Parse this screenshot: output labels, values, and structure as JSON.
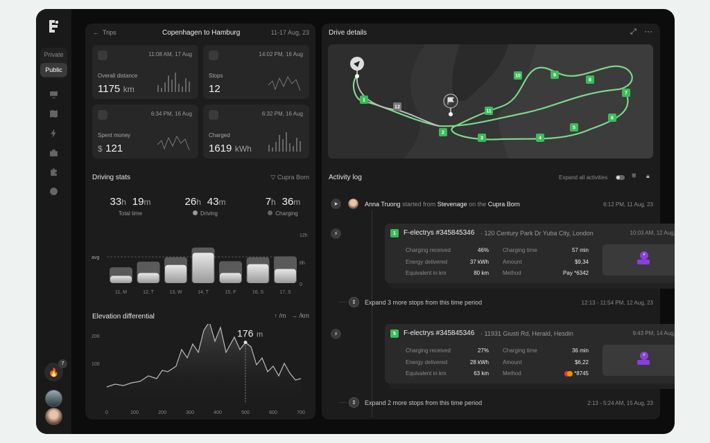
{
  "sidebar": {
    "visibility": [
      "Private",
      "Public"
    ],
    "notif_count": "7"
  },
  "trip": {
    "back": "Trips",
    "title": "Copenhagen to Hamburg",
    "dates": "11-17 Aug, 23"
  },
  "cards": [
    {
      "time": "11:08 AM, 17 Aug",
      "label": "Overall distance",
      "prefix": "",
      "value": "1175",
      "unit": "km"
    },
    {
      "time": "14:02 PM, 16 Aug",
      "label": "Stops",
      "prefix": "",
      "value": "12",
      "unit": ""
    },
    {
      "time": "6:34 PM, 16 Aug",
      "label": "Spent money",
      "prefix": "$",
      "value": "121",
      "unit": ""
    },
    {
      "time": "6:32 PM, 16 Aug",
      "label": "Charged",
      "prefix": "",
      "value": "1619",
      "unit": "kWh"
    }
  ],
  "driving": {
    "title": "Driving stats",
    "car": "Cupra Born",
    "stats": [
      {
        "h": "33",
        "hu": "h",
        "m": "19",
        "mu": "m",
        "label": "Total time"
      },
      {
        "h": "26",
        "hu": "h",
        "m": "43",
        "mu": "m",
        "label": "Driving"
      },
      {
        "h": "7",
        "hu": "h",
        "m": "36",
        "mu": "m",
        "label": "Charging"
      }
    ],
    "avg_label": "avg",
    "y_ticks": [
      "12h",
      "6h",
      "0"
    ]
  },
  "chart_data": [
    {
      "type": "bar",
      "categories": [
        "11, M",
        "12, T",
        "13, W",
        "14, T",
        "15, F",
        "16, S",
        "17, S"
      ],
      "series": [
        {
          "name": "Driving",
          "values": [
            1.8,
            2.5,
            4.5,
            7.5,
            2.5,
            4.7,
            3.5
          ]
        },
        {
          "name": "Charging",
          "values": [
            1.6,
            2.3,
            1.4,
            0.8,
            2.4,
            1.2,
            2.6
          ]
        }
      ],
      "avg": 6.5,
      "ylim": [
        0,
        12
      ]
    },
    {
      "type": "area",
      "title": "Elevation differential",
      "x_unit": "/km",
      "y_unit": "/m",
      "x_ticks": [
        "0",
        "100",
        "200",
        "300",
        "400",
        "500",
        "600",
        "700"
      ],
      "y_ticks": [
        "200",
        "100"
      ],
      "highlight": {
        "x": 500,
        "value": "176",
        "unit": "m"
      },
      "x": [
        0,
        30,
        60,
        90,
        120,
        150,
        180,
        200,
        220,
        250,
        270,
        290,
        310,
        330,
        350,
        370,
        390,
        410,
        430,
        460,
        480,
        500,
        520,
        540,
        560,
        580,
        600,
        620,
        640,
        660,
        680,
        700
      ],
      "y": [
        15,
        25,
        20,
        30,
        35,
        55,
        45,
        75,
        70,
        90,
        150,
        120,
        170,
        140,
        220,
        250,
        180,
        230,
        140,
        195,
        150,
        176,
        160,
        95,
        120,
        70,
        90,
        55,
        100,
        65,
        40,
        45
      ]
    }
  ],
  "drive": {
    "title": "Drive details"
  },
  "map": {
    "markers": [
      "1",
      "2",
      "3",
      "4",
      "5",
      "6",
      "7",
      "8",
      "9",
      "10",
      "11",
      "12"
    ]
  },
  "activity": {
    "title": "Activity log",
    "expand_all": "Expand all activities",
    "start": {
      "name": "Anna Truong",
      "verb": "started from",
      "place": "Stevenage",
      "on": "on the",
      "car": "Cupra Born",
      "time": "6:12 PM, 11 Aug, 23"
    },
    "stops": [
      {
        "num": "1",
        "name": "F-electrys #345845346",
        "addr": "· 120 Century Park Dr Yuba City, London",
        "time": "10:03 AM, 12 Aug, 23",
        "received": "46%",
        "energy": "37 kWh",
        "equiv": "80 km",
        "ctime": "57 min",
        "amount": "$9,34",
        "method_brand": "Pay",
        "method": "*6342"
      },
      {
        "num": "5",
        "name": "F-electrys #345845346",
        "addr": "· 11931 Giusti Rd, Herald, Hesdin",
        "time": "9:43 PM, 14 Aug, 23",
        "received": "27%",
        "energy": "28 kWh",
        "equiv": "63 km",
        "ctime": "36 min",
        "amount": "$6,22",
        "method_brand": "",
        "method": "*8745"
      }
    ],
    "labels": {
      "received": "Charging received",
      "energy": "Energy delivered",
      "equiv": "Equivalent in km",
      "ctime": "Charging time",
      "amount": "Amount",
      "method": "Method"
    },
    "expands": [
      {
        "text": "Expand 3 more stops from this time period",
        "time": "12:13 - 11:54 PM, 12 Aug, 23"
      },
      {
        "text": "Expand 2 more stops from this time period",
        "time": "2:13 - 5:24 AM, 15 Aug, 23"
      }
    ]
  }
}
